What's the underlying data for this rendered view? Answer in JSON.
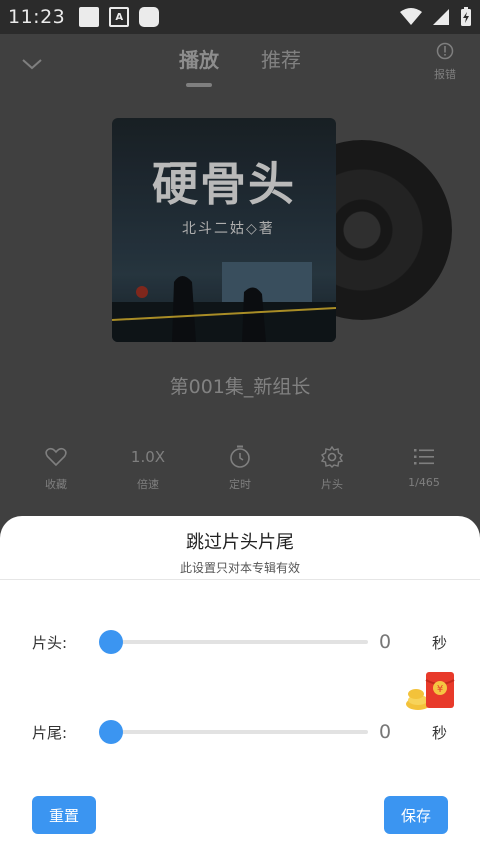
{
  "status_bar": {
    "time": "11:23",
    "a_label": "A"
  },
  "header": {
    "tabs": [
      {
        "label": "播放"
      },
      {
        "label": "推荐"
      }
    ],
    "report_label": "报错"
  },
  "album": {
    "cover_title": "硬骨头",
    "cover_author": "北斗二姑◇著"
  },
  "episode_title": "第001集_新组长",
  "actions": [
    {
      "icon": "heart-icon",
      "label": "收藏"
    },
    {
      "icon_text": "1.0X",
      "label": "倍速"
    },
    {
      "icon": "timer-icon",
      "label": "定时"
    },
    {
      "icon": "gear-icon",
      "label": "片头"
    },
    {
      "icon": "list-icon",
      "label": "1/465"
    }
  ],
  "sheet": {
    "title": "跳过片头片尾",
    "subtitle": "此设置只对本专辑有效",
    "intro": {
      "label": "片头:",
      "value": "0",
      "unit": "秒"
    },
    "outro": {
      "label": "片尾:",
      "value": "0",
      "unit": "秒"
    },
    "reset_label": "重置",
    "save_label": "保存"
  },
  "colors": {
    "accent": "#3b95f1"
  }
}
